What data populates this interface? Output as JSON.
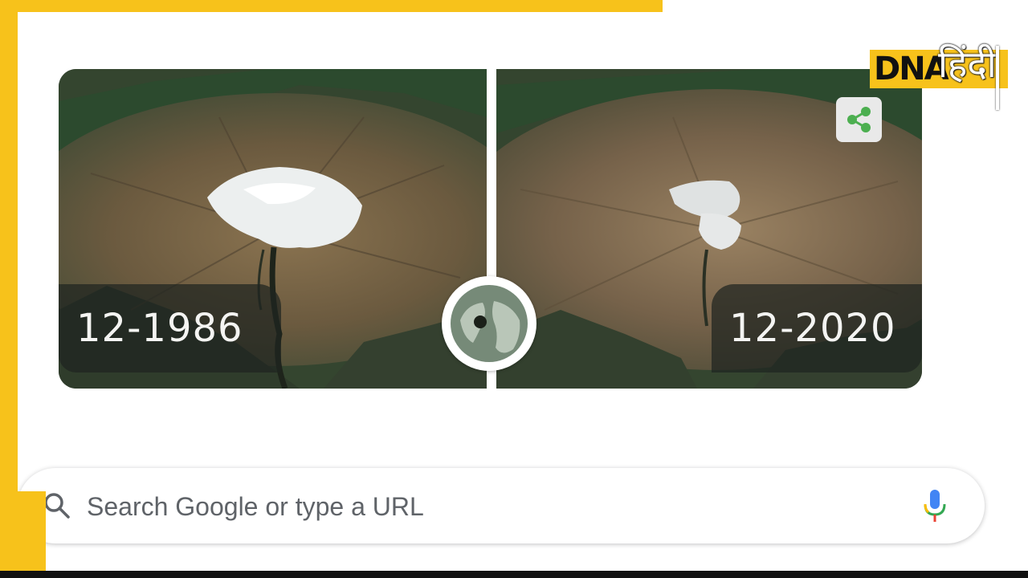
{
  "doodle": {
    "left_date": "12-1986",
    "right_date": "12-2020",
    "icons": {
      "globe": "globe-icon",
      "share": "share-icon"
    }
  },
  "logo": {
    "latin": "DNA",
    "hindi": "हिंदी"
  },
  "search": {
    "placeholder": "Search Google or type a URL",
    "icons": {
      "search": "search-icon",
      "mic": "microphone-icon"
    }
  },
  "colors": {
    "frame": "#f7c21b",
    "share_green": "#4caf50"
  }
}
